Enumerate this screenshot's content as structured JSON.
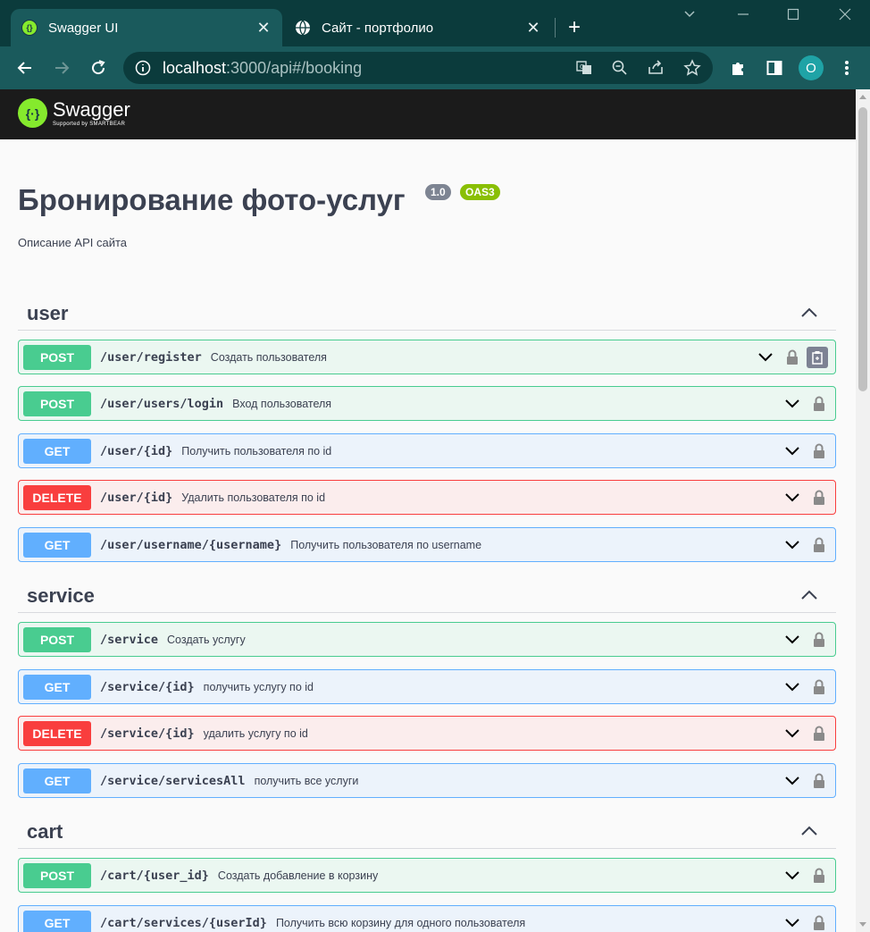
{
  "browser": {
    "tabs": [
      {
        "title": "Swagger UI",
        "active": true,
        "icon": "swagger-favicon"
      },
      {
        "title": "Сайт - портфолио",
        "active": false,
        "icon": "globe-icon"
      }
    ],
    "url_host": "localhost",
    "url_rest": ":3000/api#/booking",
    "profile_initial": "O",
    "theme_color": "#1a5a5c"
  },
  "swagger": {
    "logo_name": "Swagger",
    "logo_sub": "Supported by SMARTBEAR",
    "title": "Бронирование фото-услуг",
    "version": "1.0",
    "oas_badge": "OAS3",
    "description": "Описание API сайта"
  },
  "tags": [
    {
      "name": "user",
      "operations": [
        {
          "method": "POST",
          "path": "/user/register",
          "summary": "Создать пользователя"
        },
        {
          "method": "POST",
          "path": "/user/users/login",
          "summary": "Вход пользователя"
        },
        {
          "method": "GET",
          "path": "/user/{id}",
          "summary": "Получить пользователя по id"
        },
        {
          "method": "DELETE",
          "path": "/user/{id}",
          "summary": "Удалить пользователя по id"
        },
        {
          "method": "GET",
          "path": "/user/username/{username}",
          "summary": "Получить пользователя по username"
        }
      ]
    },
    {
      "name": "service",
      "operations": [
        {
          "method": "POST",
          "path": "/service",
          "summary": "Создать услугу"
        },
        {
          "method": "GET",
          "path": "/service/{id}",
          "summary": "получить услугу по id"
        },
        {
          "method": "DELETE",
          "path": "/service/{id}",
          "summary": "удалить услугу по id"
        },
        {
          "method": "GET",
          "path": "/service/servicesAll",
          "summary": "получить все услуги"
        }
      ]
    },
    {
      "name": "cart",
      "operations": [
        {
          "method": "POST",
          "path": "/cart/{user_id}",
          "summary": "Создать добавление в корзину"
        },
        {
          "method": "GET",
          "path": "/cart/services/{userId}",
          "summary": "Получить всю корзину для одного пользователя"
        }
      ]
    }
  ],
  "colors": {
    "post": "#49cc90",
    "get": "#61affe",
    "delete": "#f93e3e"
  }
}
